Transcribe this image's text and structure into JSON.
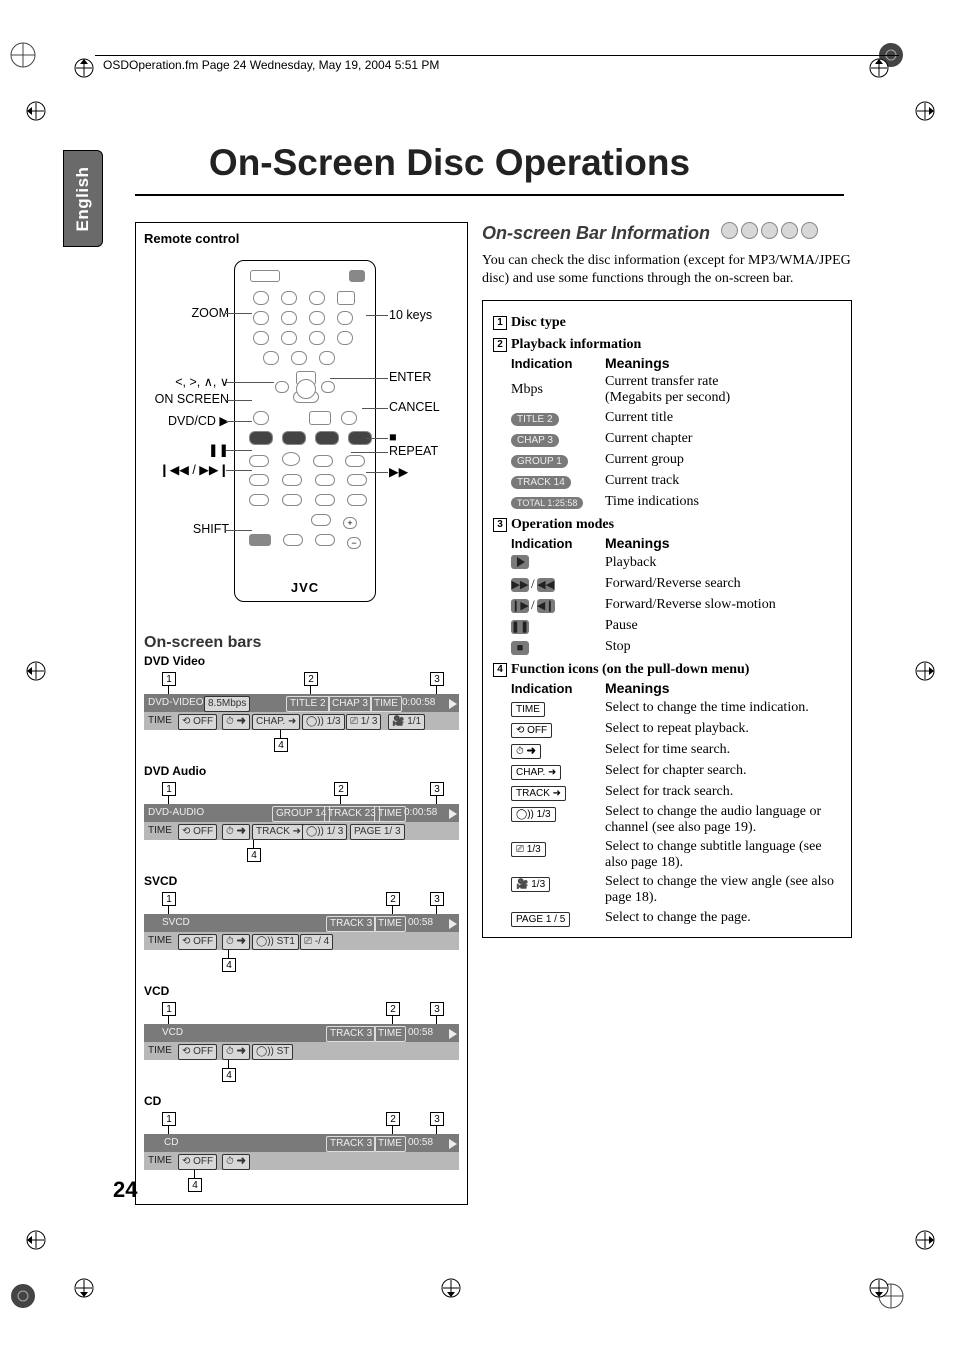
{
  "header": "OSDOperation.fm  Page 24  Wednesday, May 19, 2004  5:51 PM",
  "side_tab": "English",
  "title": "On-Screen Disc Operations",
  "page_number": "24",
  "left": {
    "remote_title": "Remote control",
    "jvc": "JVC",
    "labels": {
      "zoom": "ZOOM",
      "arrows": "<, >, ∧, ∨",
      "onscreen": "ON SCREEN",
      "dvdcd": "DVD/CD ▶",
      "pause": "❚❚",
      "prevnext": "❙◀◀ / ▶▶❙",
      "shift": "SHIFT",
      "tenkeys": "10 keys",
      "enter": "ENTER",
      "cancel": "CANCEL",
      "stop": "■",
      "repeat": "REPEAT",
      "ff": "▶▶"
    },
    "osb_title": "On-screen bars",
    "bars": {
      "dvdvideo": {
        "title": "DVD Video",
        "top": {
          "disc": "DVD-VIDEO",
          "mbps": "8.5Mbps",
          "title": "TITLE  2",
          "chap": "CHAP  3",
          "time_l": "TIME",
          "time_v": "0:00:58"
        },
        "bot": {
          "time": "TIME",
          "repeat": "⟲ OFF",
          "tsearch": "⏱ ➜",
          "csearch": "CHAP. ➜",
          "audio": "◯)) 1/3",
          "sub": "⎚ 1/ 3",
          "angle": "🎥 1/1"
        }
      },
      "dvdaudio": {
        "title": "DVD Audio",
        "top": {
          "disc": "DVD-AUDIO",
          "group": "GROUP 14",
          "track": "TRACK 23",
          "time_l": "TIME",
          "time_v": "0:00:58"
        },
        "bot": {
          "time": "TIME",
          "repeat": "⟲ OFF",
          "tsearch": "⏱ ➜",
          "trksearch": "TRACK ➜",
          "audio": "◯)) 1/ 3",
          "page": "PAGE 1/ 3"
        }
      },
      "svcd": {
        "title": "SVCD",
        "top": {
          "disc": "SVCD",
          "track": "TRACK  3",
          "time_l": "TIME",
          "time_v": "00:58"
        },
        "bot": {
          "time": "TIME",
          "repeat": "⟲ OFF",
          "tsearch": "⏱ ➜",
          "audio": "◯)) ST1",
          "sub": "⎚ -/ 4"
        }
      },
      "vcd": {
        "title": "VCD",
        "top": {
          "disc": "VCD",
          "track": "TRACK  3",
          "time_l": "TIME",
          "time_v": "00:58"
        },
        "bot": {
          "time": "TIME",
          "repeat": "⟲ OFF",
          "tsearch": "⏱ ➜",
          "audio": "◯)) ST"
        }
      },
      "cd": {
        "title": "CD",
        "top": {
          "disc": "CD",
          "track": "TRACK  3",
          "time_l": "TIME",
          "time_v": "00:58"
        },
        "bot": {
          "time": "TIME",
          "repeat": "⟲ OFF",
          "tsearch": "⏱ ➜"
        }
      }
    },
    "nums": [
      "1",
      "2",
      "3",
      "4"
    ]
  },
  "right": {
    "heading": "On-screen Bar Information",
    "para": "You can check the disc information (except for MP3/WMA/JPEG disc) and use some functions through the on-screen bar.",
    "sec1": "Disc type",
    "sec2": "Playback information",
    "indication": "Indication",
    "meanings": "Meanings",
    "mbps": {
      "label": "Mbps",
      "mean1": "Current transfer rate",
      "mean2": "(Megabits per second)"
    },
    "title_i": {
      "label": "TITLE  2",
      "mean": "Current title"
    },
    "chap_i": {
      "label": "CHAP  3",
      "mean": "Current chapter"
    },
    "group_i": {
      "label": "GROUP 1",
      "mean": "Current group"
    },
    "track_i": {
      "label": "TRACK 14",
      "mean": "Current track"
    },
    "total_i": {
      "label": "TOTAL 1:25:58",
      "mean": "Time indications"
    },
    "sec3": "Operation modes",
    "op_play": "Playback",
    "op_search": "Forward/Reverse search",
    "op_slow": "Forward/Reverse slow-motion",
    "op_pause": "Pause",
    "op_stop": "Stop",
    "sec4": "Function icons (on the pull-down menu)",
    "fi_time": {
      "label": "TIME",
      "mean": "Select to change the time indication."
    },
    "fi_repeat": {
      "label": "⟲ OFF",
      "mean": "Select to repeat playback."
    },
    "fi_tsearch": {
      "label": "⏱ ➜",
      "mean": "Select for time search."
    },
    "fi_csearch": {
      "label": "CHAP. ➜",
      "mean": "Select for chapter search."
    },
    "fi_trksearch": {
      "label": "TRACK ➜",
      "mean": "Select for track search."
    },
    "fi_audio": {
      "label": "◯))  1/3",
      "mean": "Select to change the audio language or channel (see also page 19)."
    },
    "fi_sub": {
      "label": "⎚   1/3",
      "mean": "Select to change subtitle language (see also page 18)."
    },
    "fi_angle": {
      "label": "🎥 1/3",
      "mean": "Select to change the view angle (see also page 18)."
    },
    "fi_page": {
      "label": "PAGE  1 / 5",
      "mean": "Select to change the page."
    }
  }
}
